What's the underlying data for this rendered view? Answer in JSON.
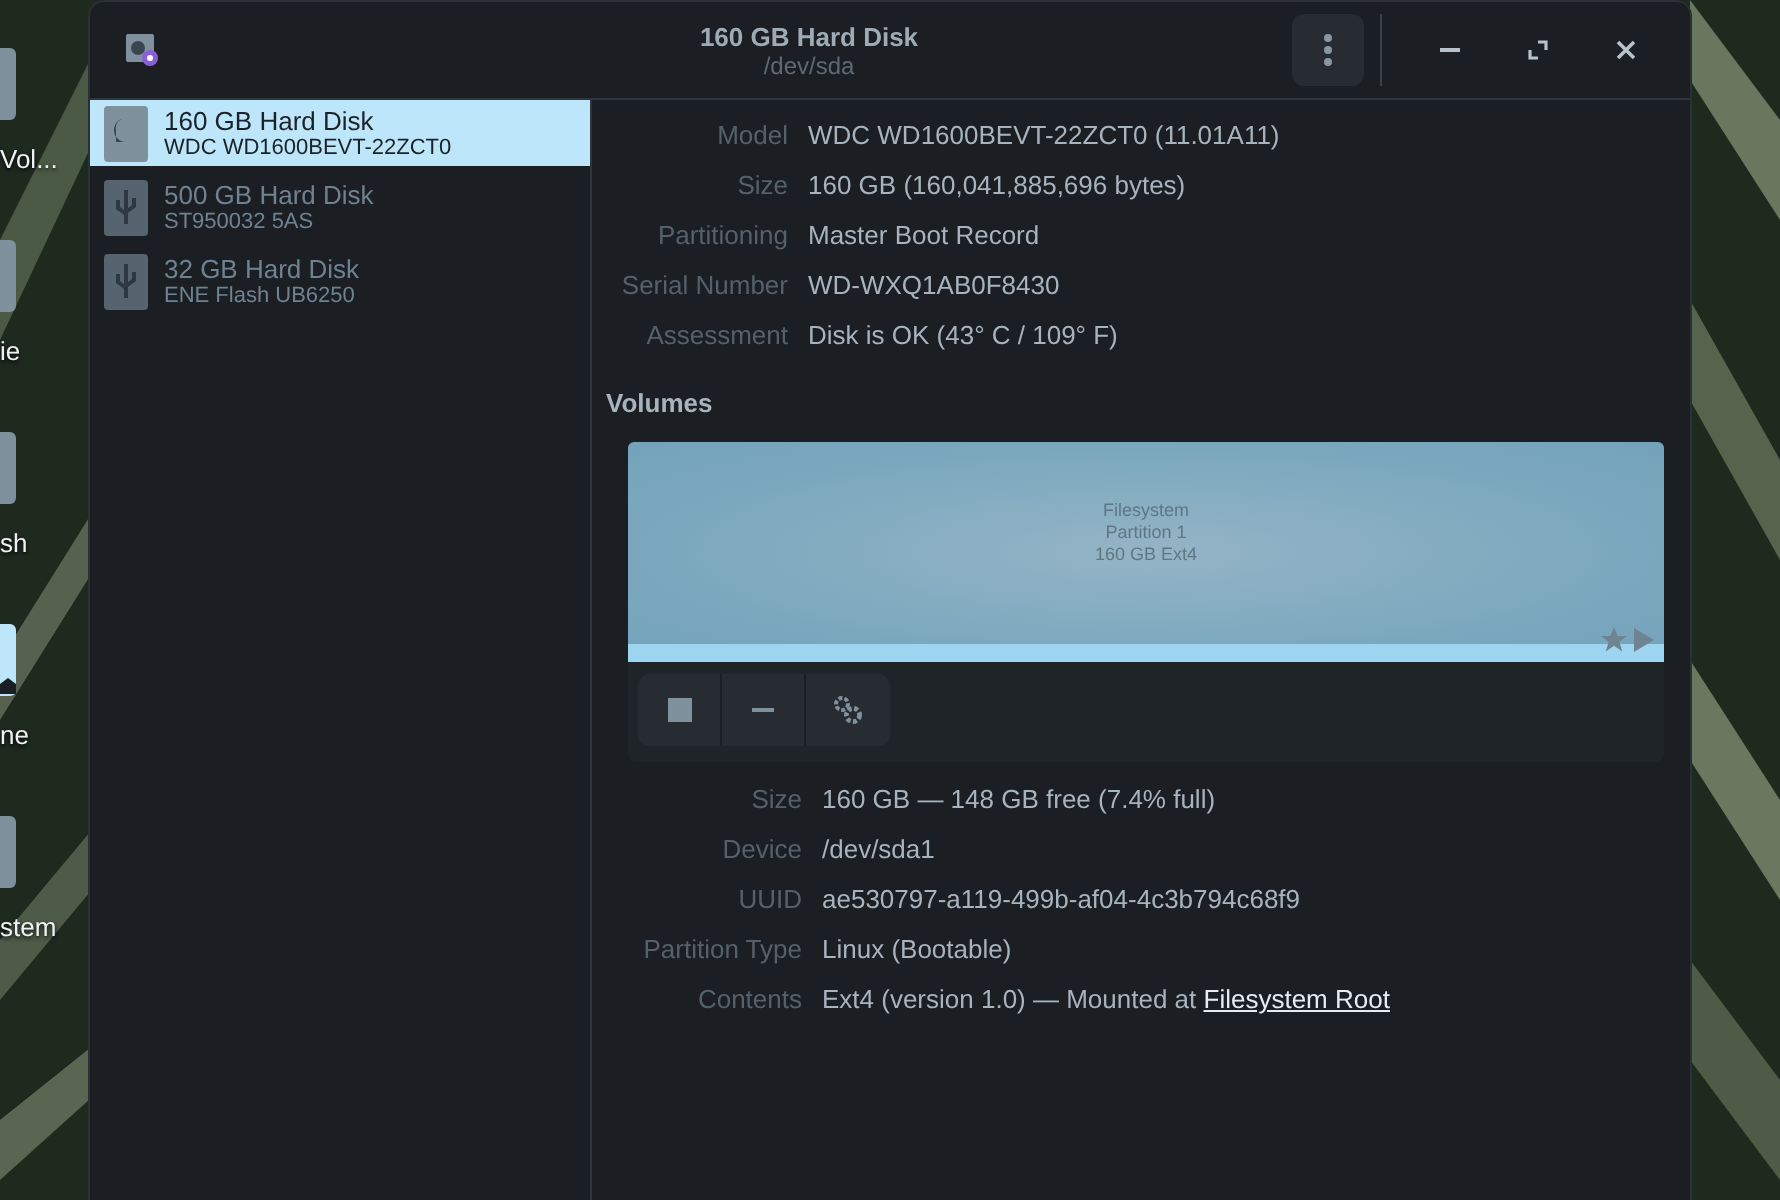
{
  "desktop": {
    "icons": [
      {
        "label": "Vol...",
        "kind": "drive"
      },
      {
        "label": "ie",
        "kind": "drive"
      },
      {
        "label": "sh",
        "kind": "trash"
      },
      {
        "label": "ne",
        "kind": "home"
      },
      {
        "label": "stem",
        "kind": "drive"
      }
    ]
  },
  "window": {
    "title": "160 GB Hard Disk",
    "subtitle": "/dev/sda"
  },
  "sidebar": {
    "items": [
      {
        "name": "160 GB Hard Disk",
        "model": "WDC WD1600BEVT-22ZCT0",
        "kind": "hdd",
        "selected": true
      },
      {
        "name": "500 GB Hard Disk",
        "model": "ST950032 5AS",
        "kind": "usb",
        "selected": false
      },
      {
        "name": "32 GB Hard Disk",
        "model": "ENE Flash UB6250",
        "kind": "usb",
        "selected": false
      }
    ]
  },
  "drive_info": [
    {
      "label": "Model",
      "value": "WDC WD1600BEVT-22ZCT0 (11.01A11)"
    },
    {
      "label": "Size",
      "value": "160 GB (160,041,885,696 bytes)"
    },
    {
      "label": "Partitioning",
      "value": "Master Boot Record"
    },
    {
      "label": "Serial Number",
      "value": "WD-WXQ1AB0F8430"
    },
    {
      "label": "Assessment",
      "value": "Disk is OK (43° C / 109° F)"
    }
  ],
  "volumes": {
    "heading": "Volumes",
    "partition": {
      "lines": [
        "Filesystem",
        "Partition 1",
        "160 GB Ext4"
      ]
    },
    "info": [
      {
        "label": "Size",
        "value": "160 GB — 148 GB free (7.4% full)"
      },
      {
        "label": "Device",
        "value": "/dev/sda1"
      },
      {
        "label": "UUID",
        "value": "ae530797-a119-499b-af04-4c3b794c68f9"
      },
      {
        "label": "Partition Type",
        "value": "Linux (Bootable)"
      },
      {
        "label": "Contents",
        "value": "Ext4 (version 1.0) — Mounted at ",
        "link": "Filesystem Root"
      }
    ]
  }
}
